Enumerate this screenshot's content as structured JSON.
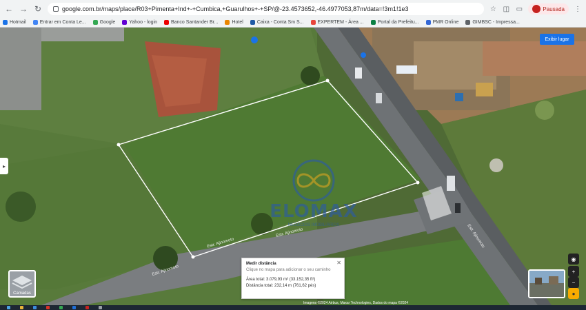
{
  "browser": {
    "url": "google.com.br/maps/place/R03+Pimenta+Ind+-+Cumbica,+Guarulhos+-+SP/@-23.4573652,-46.4977053,87m/data=!3m1!1e3",
    "paused_label": "Pausada"
  },
  "bookmarks": [
    {
      "label": "Hotmail",
      "color": "#1a73e8"
    },
    {
      "label": "Entrar em Conta Le...",
      "color": "#4285f4"
    },
    {
      "label": "Google",
      "color": "#34a853"
    },
    {
      "label": "Yahoo - login",
      "color": "#6001d2"
    },
    {
      "label": "Banco Santander Br...",
      "color": "#ec0000"
    },
    {
      "label": "Hotel",
      "color": "#ea8600"
    },
    {
      "label": "Caixa - Conta Sm S...",
      "color": "#1f5aa6"
    },
    {
      "label": "EXPERTEM - Área ...",
      "color": "#e8453c"
    },
    {
      "label": "Portal da Prefeitu...",
      "color": "#0b8043"
    },
    {
      "label": "PMR Online",
      "color": "#3367d6"
    },
    {
      "label": "GIMBSC - Impressa...",
      "color": "#5f6368"
    }
  ],
  "map": {
    "satellite_button": "Exibir lugar",
    "layers_label": "Camadas",
    "attribution": "Imagens ©2024 Airbus, Maxar Technologies, Dados do mapa ©2024",
    "street_labels": [
      "Estr. Ajinomoto",
      "Estr. Ajinomoto",
      "Estr. Ajinomoto",
      "Estr. Ajinomoto"
    ]
  },
  "measure_card": {
    "title": "Medir distância",
    "hint": "Clique no mapa para adicionar o seu caminho",
    "area": "Área total: 3.079,93 m² (33.152,35 ft²)",
    "distance": "Distância total: 232,14 m (761,62 pés)"
  },
  "watermark": {
    "brand": "ELOMAX",
    "tagline": "NEGÓCIOS IMOBILIÁRIOS"
  }
}
